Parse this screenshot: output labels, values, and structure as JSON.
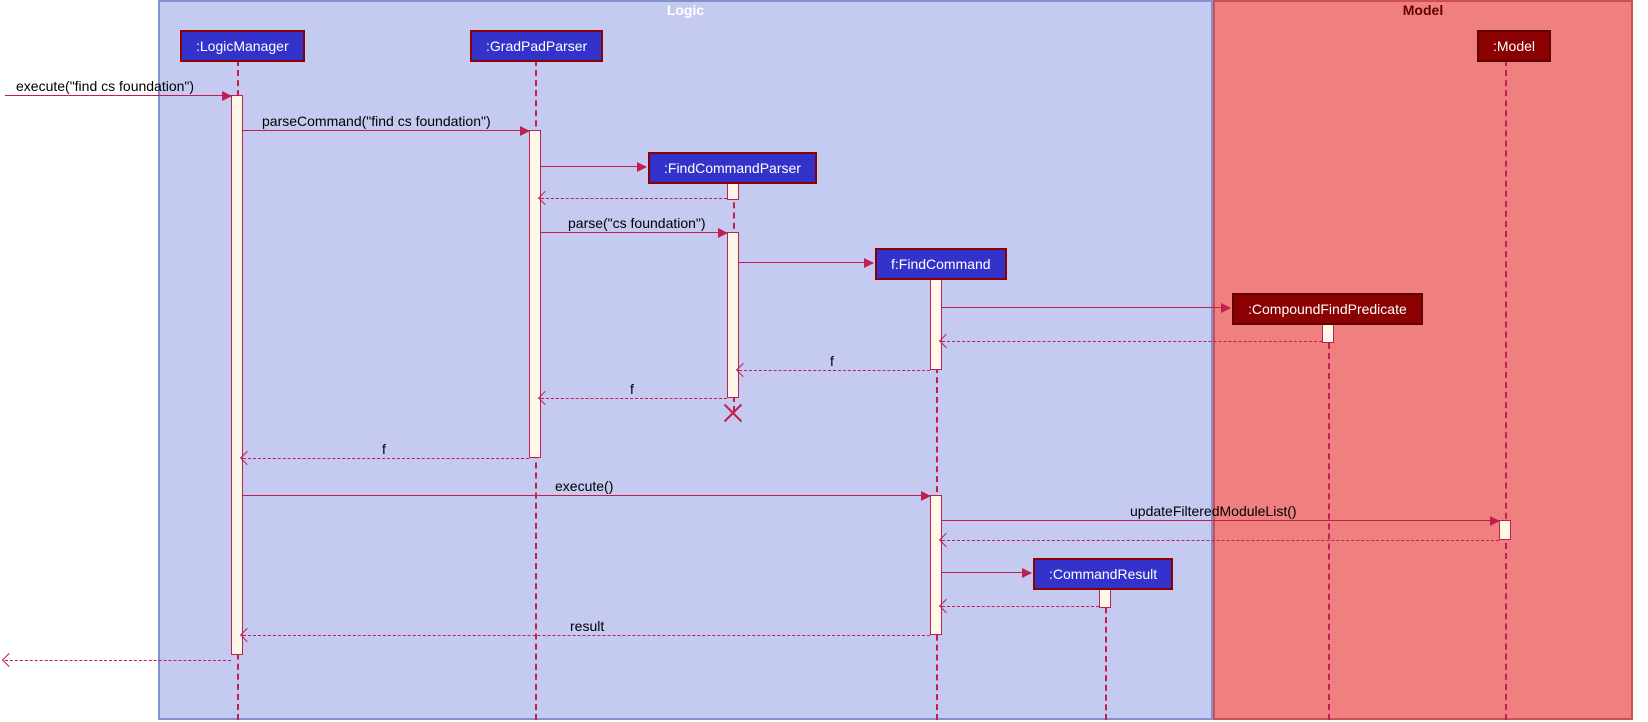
{
  "frames": {
    "logic": {
      "title": "Logic"
    },
    "model": {
      "title": "Model"
    }
  },
  "participants": {
    "logicManager": ":LogicManager",
    "gradPadParser": ":GradPadParser",
    "findCommandParser": ":FindCommandParser",
    "findCommand": "f:FindCommand",
    "compoundFindPredicate": ":CompoundFindPredicate",
    "commandResult": ":CommandResult",
    "model": ":Model"
  },
  "messages": {
    "execute1": "execute(\"find cs foundation\")",
    "parseCommand": "parseCommand(\"find cs foundation\")",
    "parse": "parse(\"cs foundation\")",
    "returnF1": "f",
    "returnF2": "f",
    "returnF3": "f",
    "execute2": "execute()",
    "updateFilteredModuleList": "updateFilteredModuleList()",
    "result": "result"
  }
}
